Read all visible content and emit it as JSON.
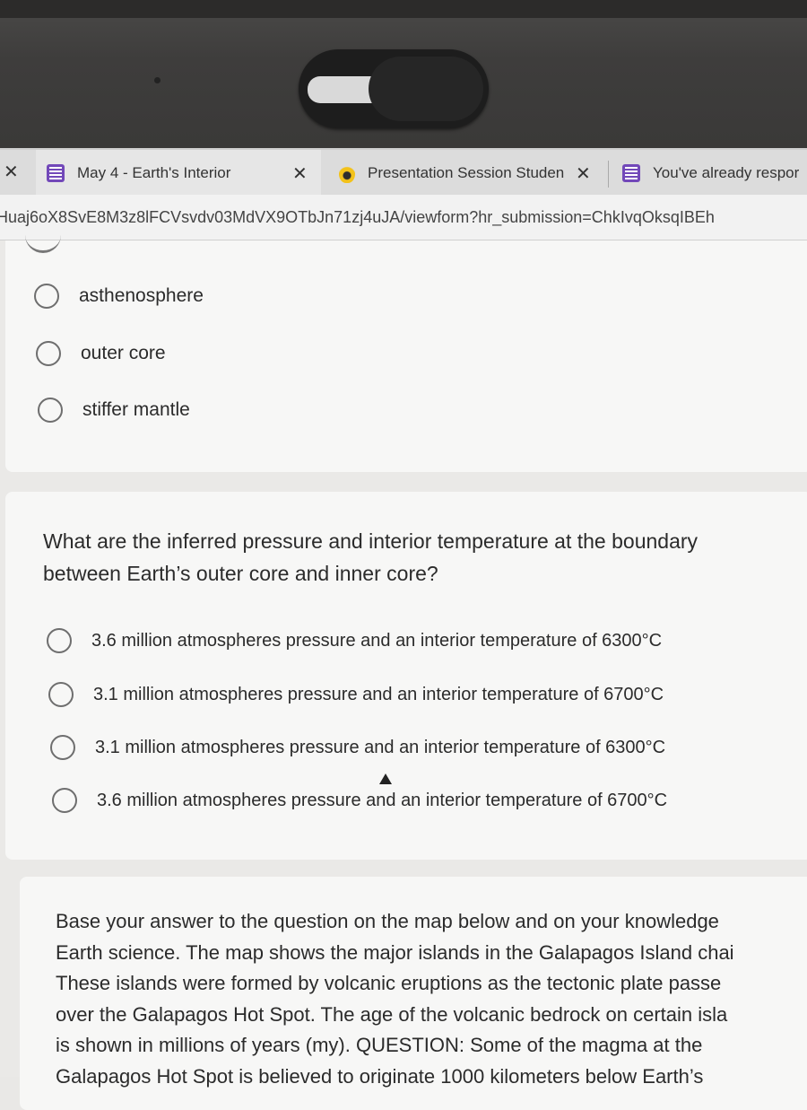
{
  "browser": {
    "tabs": [
      {
        "title": "May 4 - Earth's Interior",
        "icon": "google-forms-icon"
      },
      {
        "title": "Presentation Session Studen",
        "icon": "google-slides-icon"
      },
      {
        "title": "You've already respor",
        "icon": "google-forms-icon"
      }
    ],
    "url": "Huaj6oX8SvE8M3z8lFCVsvdv03MdVX9OTbJn71zj4uJA/viewform?hr_submission=ChkIvqOksqIBEh"
  },
  "question_prev": {
    "options": [
      "asthenosphere",
      "outer core",
      "stiffer mantle"
    ]
  },
  "question_current": {
    "text_line1": "What are the inferred pressure and interior temperature at the boundary",
    "text_line2": "between Earth’s outer core and inner core?",
    "options": [
      "3.6 million atmospheres pressure and an interior temperature of 6300°C",
      "3.1 million atmospheres pressure and an interior temperature of 6700°C",
      "3.1 million atmospheres pressure and an interior temperature of 6300°C",
      "3.6 million atmospheres pressure and an interior temperature of 6700°C"
    ]
  },
  "question_next": {
    "lines": [
      "Base your answer to the question on the map below and on your knowledge",
      "Earth science. The map shows the major islands in the Galapagos Island chai",
      "These islands were formed by volcanic eruptions as the tectonic plate passe",
      "over the Galapagos Hot Spot. The age of the volcanic bedrock on certain isla",
      "is shown in millions of years (my). QUESTION: Some of the magma at the",
      "Galapagos Hot Spot is believed to originate 1000 kilometers below Earth’s"
    ]
  }
}
